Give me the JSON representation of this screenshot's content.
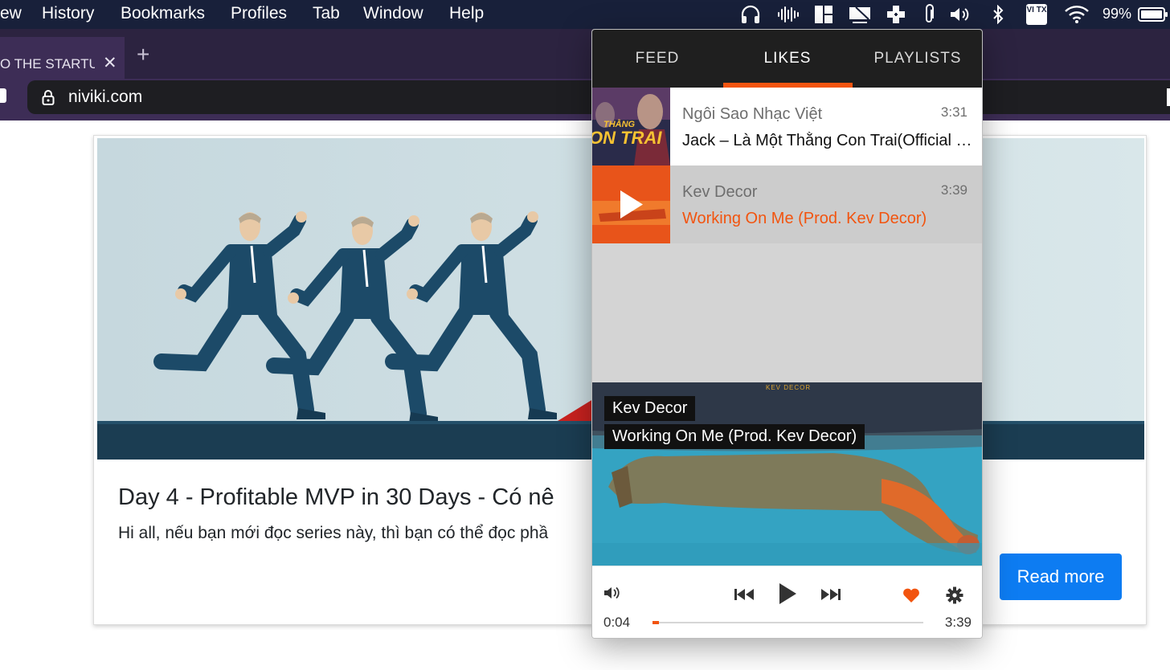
{
  "menubar": {
    "items": [
      "ew",
      "History",
      "Bookmarks",
      "Profiles",
      "Tab",
      "Window",
      "Help"
    ],
    "tray": {
      "input_source": "VI TX",
      "battery": "99%"
    }
  },
  "browser": {
    "tab_title": "O THE STARTUP",
    "url": "niviki.com"
  },
  "post": {
    "title": "Day 4 - Profitable MVP in 30 Days - Có nê",
    "excerpt": "Hi all, nếu bạn mới đọc series này, thì bạn có thể đọc phầ",
    "read_more": "Read more"
  },
  "player": {
    "tabs": [
      "FEED",
      "LIKES",
      "PLAYLISTS"
    ],
    "active_tab": "LIKES",
    "tracks": [
      {
        "artist": "Ngôi Sao Nhạc Việt",
        "title": "Jack – Là Một Thằng Con Trai(Official MV)",
        "duration": "3:31",
        "thumb_text_1": "THẰNG",
        "thumb_text_2": "ON TRAI"
      },
      {
        "artist": "Kev Decor",
        "title": "Working On Me (Prod. Kev Decor)",
        "duration": "3:39"
      }
    ],
    "now_playing": {
      "artist": "Kev Decor",
      "title": "Working On Me (Prod. Kev Decor)",
      "cover_brand": "KEV DECOR"
    },
    "time_current": "0:04",
    "time_total": "3:39",
    "progress": 0.02,
    "liked": true,
    "colors": {
      "accent": "#f2540f"
    }
  }
}
